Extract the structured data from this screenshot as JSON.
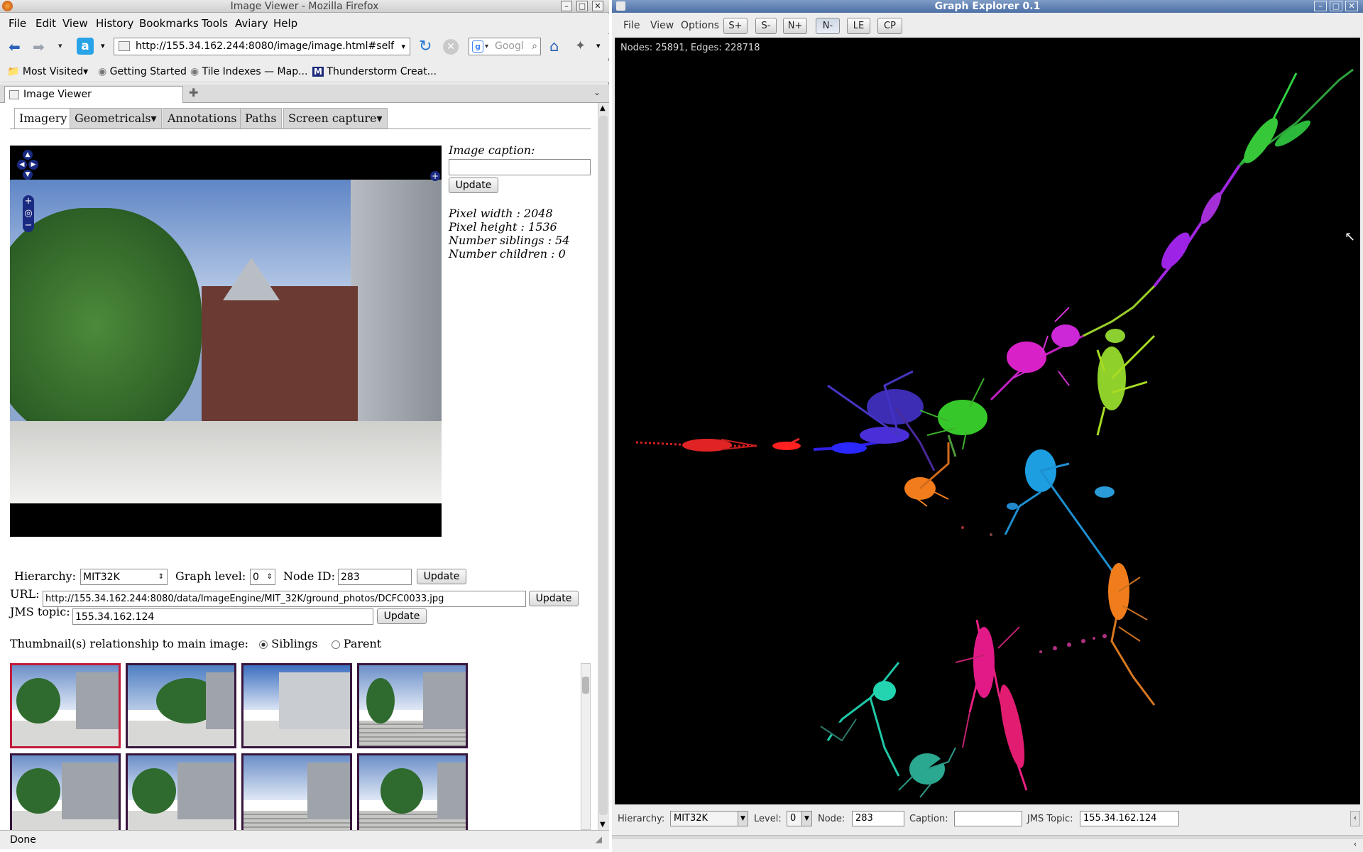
{
  "firefox": {
    "window_title": "Image Viewer - Mozilla Firefox",
    "menu": [
      "File",
      "Edit",
      "View",
      "History",
      "Bookmarks",
      "Tools",
      "Aviary",
      "Help"
    ],
    "url": "http://155.34.162.244:8080/image/image.html#self",
    "search_placeholder": "Googl",
    "bookmarks": [
      "Most Visited▾",
      "Getting Started",
      "Tile Indexes — Map...",
      "Thunderstorm Creat..."
    ],
    "tab_title": "Image Viewer",
    "status": "Done"
  },
  "viewer": {
    "tabs": [
      "Imagery",
      "Geometricals▾",
      "Annotations",
      "Paths",
      "Screen capture▾"
    ],
    "caption_label": "Image caption:",
    "caption_value": "",
    "update_label": "Update",
    "info": {
      "pixel_width": "Pixel width : 2048",
      "pixel_height": "Pixel height : 1536",
      "siblings": "Number siblings : 54",
      "children": "Number children : 0"
    },
    "hierarchy_label": "Hierarchy:",
    "hierarchy_value": "MIT32K",
    "graph_level_label": "Graph level:",
    "graph_level_value": "0",
    "node_id_label": "Node ID:",
    "node_id_value": "283",
    "url_label": "URL:",
    "url_value": "http://155.34.162.244:8080/data/ImageEngine/MIT_32K/ground_photos/DCFC0033.jpg",
    "jms_label": "JMS topic:",
    "jms_value": "155.34.162.124",
    "relationship_label": "Thumbnail(s) relationship to main image:",
    "relationship_options": [
      "Siblings",
      "Parent"
    ],
    "relationship_selected": "Siblings"
  },
  "graph_explorer": {
    "window_title": "Graph Explorer 0.1",
    "menu": [
      "File",
      "View",
      "Options"
    ],
    "toolbar": [
      "S+",
      "S-",
      "N+",
      "N-",
      "LE",
      "CP"
    ],
    "pressed_button": "N-",
    "stats": "Nodes: 25891, Edges: 228718",
    "hierarchy_label": "Hierarchy:",
    "hierarchy_value": "MIT32K",
    "level_label": "Level:",
    "level_value": "0",
    "node_label": "Node:",
    "node_value": "283",
    "caption_label": "Caption:",
    "caption_value": "",
    "jms_label": "JMS Topic:",
    "jms_value": "155.34.162.124"
  },
  "colors": {
    "graph_background": "#000000",
    "selected_thumb_border": "#c21b3a",
    "thumb_border": "#38163e",
    "ge_titlebar": "#4c6fa5"
  }
}
